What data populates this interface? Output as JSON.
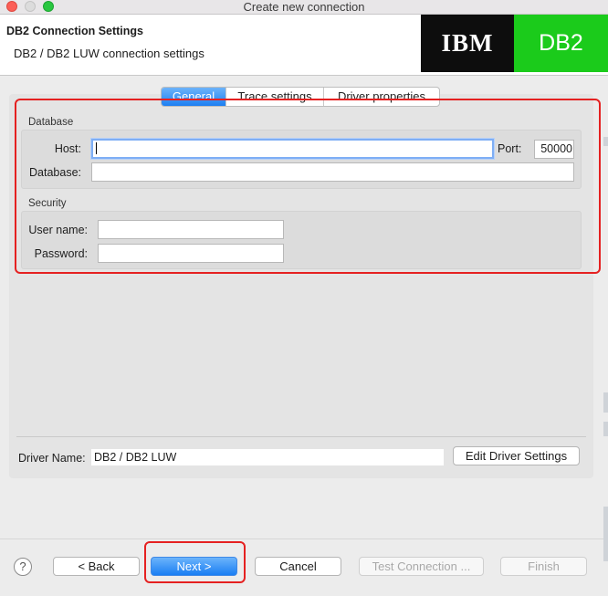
{
  "window": {
    "title": "Create new connection"
  },
  "header": {
    "title": "DB2 Connection Settings",
    "subtitle": "DB2 / DB2 LUW connection settings",
    "logo_left": "IBM",
    "logo_right": "DB2",
    "colors": {
      "ibm_bg": "#0d0d0d",
      "db2_bg": "#1bcb1b"
    }
  },
  "tabs": [
    {
      "label": "General",
      "active": true
    },
    {
      "label": "Trace settings",
      "active": false
    },
    {
      "label": "Driver properties",
      "active": false
    }
  ],
  "database_group": {
    "label": "Database",
    "host_label": "Host:",
    "host_value": "",
    "port_label": "Port:",
    "port_value": "50000",
    "database_label": "Database:",
    "database_value": ""
  },
  "security_group": {
    "label": "Security",
    "username_label": "User name:",
    "username_value": "",
    "password_label": "Password:",
    "password_value": ""
  },
  "driver": {
    "label": "Driver Name:",
    "value": "DB2 / DB2 LUW",
    "edit_button": "Edit Driver Settings"
  },
  "footer": {
    "help": "?",
    "back": "< Back",
    "next": "Next >",
    "cancel": "Cancel",
    "test": "Test Connection ...",
    "finish": "Finish"
  },
  "colors": {
    "highlight": "#e52121",
    "accent": "#1a7ef3"
  }
}
